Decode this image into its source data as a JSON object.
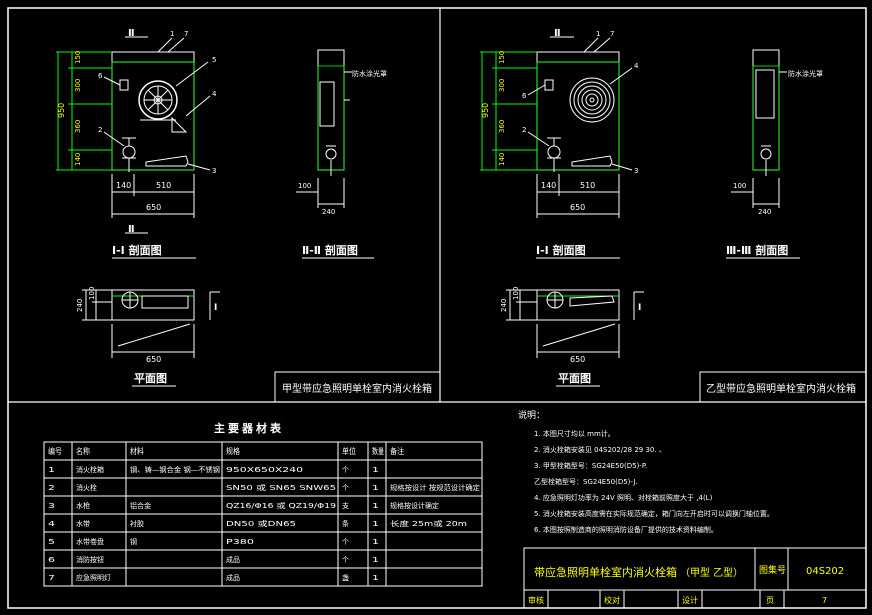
{
  "sheet": {
    "left_views": {
      "marker_top": "Ⅱ",
      "marker_bottom": "Ⅱ",
      "callouts": [
        "1",
        "7",
        "5",
        "4",
        "6",
        "2",
        "3"
      ],
      "dims_v": [
        "150",
        "300",
        "360",
        "140"
      ],
      "dim_total": "950",
      "dims_h": [
        "140",
        "510"
      ],
      "dim_width": "650",
      "title_11": "Ⅰ-Ⅰ 剖面图",
      "title_22": "Ⅱ-Ⅱ 剖面图",
      "label_side": "防水涂光罩",
      "side_dims": [
        "100",
        "240"
      ],
      "plan_title": "平面图",
      "plan_dims": [
        "240",
        "100"
      ],
      "plan_width": "650",
      "plan_marker": "Ⅰ",
      "caption": "甲型带应急照明单栓室内消火栓箱"
    },
    "right_views": {
      "marker_top": "Ⅱ",
      "callouts": [
        "1",
        "7",
        "4",
        "6",
        "2",
        "3"
      ],
      "dims_v": [
        "150",
        "300",
        "360",
        "140"
      ],
      "dim_total": "950",
      "dims_h": [
        "140",
        "510"
      ],
      "dim_width": "650",
      "title_11": "Ⅰ-Ⅰ 剖面图",
      "title_22": "Ⅲ-Ⅲ 剖面图",
      "label_side": "防水涂光罩",
      "side_dims": [
        "100",
        "240"
      ],
      "plan_title": "平面图",
      "plan_dims": [
        "240",
        "100"
      ],
      "plan_width": "650",
      "plan_marker": "Ⅰ",
      "caption": "乙型带应急照明单栓室内消火栓箱"
    },
    "material_table": {
      "title": "主要器材表",
      "headers": [
        "编号",
        "名称",
        "材料",
        "规格",
        "单位",
        "数量",
        "备注"
      ],
      "rows": [
        [
          "1",
          "消火栓箱",
          "钢、铸—钢合金 钢—不锈钢",
          "950X650X240",
          "个",
          "1",
          ""
        ],
        [
          "2",
          "消火栓",
          "",
          "SN50 或 SN65 SNW65",
          "个",
          "1",
          "规格按设计 按规范设计确定"
        ],
        [
          "3",
          "水枪",
          "铝合金",
          "QZ16/Φ16 或 QZ19/Φ19",
          "支",
          "1",
          "规格按设计确定"
        ],
        [
          "4",
          "水带",
          "衬胶",
          "DN50 或DN65",
          "条",
          "1",
          "长度 25m或 20m"
        ],
        [
          "5",
          "水带卷盘",
          "钢",
          "P380",
          "个",
          "1",
          ""
        ],
        [
          "6",
          "消防按钮",
          "",
          "成品",
          "个",
          "1",
          ""
        ],
        [
          "7",
          "应急照明灯",
          "",
          "成品",
          "盏",
          "1",
          ""
        ]
      ]
    },
    "notes": {
      "heading": "说明：",
      "items": [
        "1. 本图尺寸均以 mm计。",
        "2. 消火栓箱安装见 04S202/28 29 30. 、",
        "3. 甲型栓箱型号：SG24E50(D5)-P.",
        "   乙型栓箱型号：SG24E50(D5)-J.",
        "4. 应急照明灯功率为 24V 照明、对栓箱前照度大于 ,4(L)",
        "5. 消火栓箱安装高度需在实际规范确定，箱门向左开启时可以调换门轴位置。",
        "6. 本图按照制造商的照明消防设备厂提供的技术资料编制。"
      ]
    },
    "title_block": {
      "title": "带应急照明单栓室内消火栓箱",
      "subtitle": "（甲型 乙型）",
      "atlas_label": "图集号",
      "atlas_no": "04S202",
      "row2": [
        "审核",
        "",
        "校对",
        "",
        "设计",
        "",
        "页",
        "7"
      ]
    }
  }
}
